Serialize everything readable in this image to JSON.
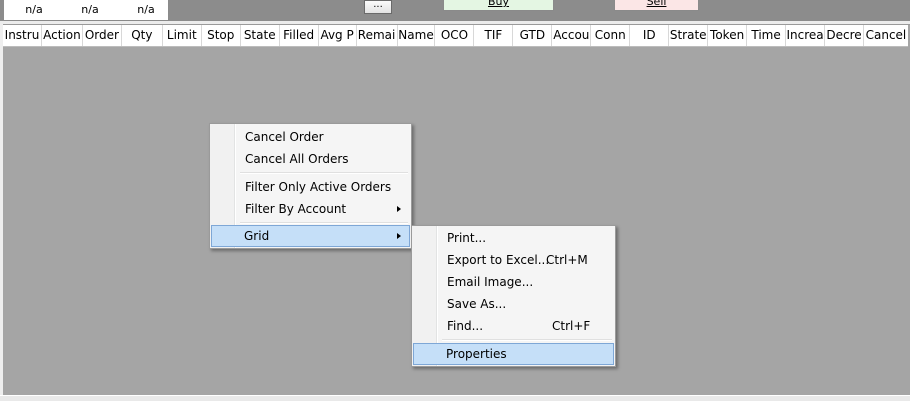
{
  "top": {
    "na_values": [
      "n/a",
      "n/a",
      "n/a"
    ],
    "ellipsis_label": "...",
    "buy_label": "Buy",
    "sell_label": "Sell"
  },
  "grid": {
    "columns": [
      "Instru",
      "Action",
      "Order",
      "Qty",
      "Limit",
      "Stop",
      "State",
      "Filled",
      "Avg P",
      "Remai",
      "Name",
      "OCO",
      "TIF",
      "GTD",
      "Accou",
      "Conn",
      "ID",
      "Strate",
      "Token",
      "Time",
      "Increa",
      "Decre",
      "Cancel"
    ]
  },
  "context_menu": {
    "cancel_order": "Cancel Order",
    "cancel_all_orders": "Cancel All Orders",
    "filter_active": "Filter Only Active Orders",
    "filter_account": "Filter By Account",
    "grid": "Grid"
  },
  "grid_submenu": {
    "print": "Print...",
    "export": "Export to Excel...",
    "export_shortcut": "Ctrl+M",
    "email": "Email Image...",
    "save_as": "Save As...",
    "find": "Find...",
    "find_shortcut": "Ctrl+F",
    "properties": "Properties"
  },
  "colors": {
    "grid_background": "#a5a5a5",
    "highlight": "#c5dff8",
    "highlight_border": "#7ea7d6",
    "buy": "#e4f6e3",
    "sell": "#fbe6e6"
  }
}
